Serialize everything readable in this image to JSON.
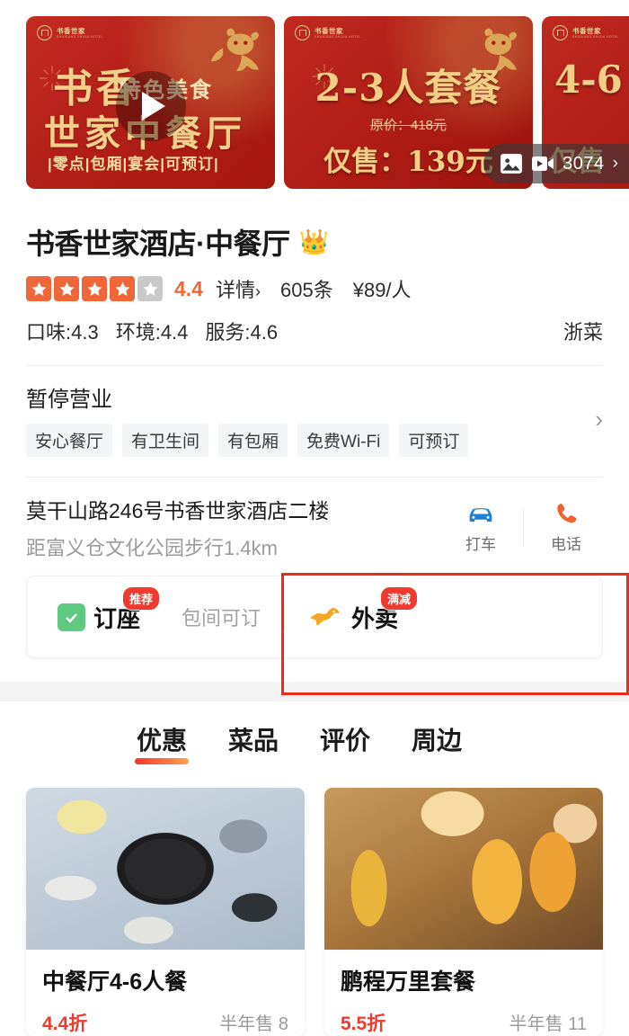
{
  "carousel": {
    "slides": [
      {
        "brand_name": "书香世家",
        "brand_sub": "SHUXIANG SHIJIA HOTEL",
        "line1": "书香",
        "subtitle": "特色美食",
        "line2": "世家中餐厅",
        "footer": "|零点|包厢|宴会|可预订|",
        "has_play": true
      },
      {
        "brand_name": "书香世家",
        "brand_sub": "SHUXIANG SHIJIA HOTEL",
        "headline": "2-3人套餐",
        "original_price": "原价：418元",
        "sale_price": "仅售：139元"
      },
      {
        "brand_name": "书香世家",
        "brand_sub": "SHUXIANG SHIJIA HOTEL",
        "headline": "4-6",
        "sale_price": "仅售"
      }
    ],
    "media_badge": {
      "photo_icon": "image-icon",
      "video_icon": "video-icon",
      "count": "3074",
      "chevron": "›"
    }
  },
  "shop": {
    "title": "书香世家酒店·中餐厅",
    "crown": "👑",
    "rating": {
      "filled_stars": 4,
      "total_stars": 5,
      "score": "4.4",
      "detail_label": "详情",
      "detail_chevron": "›",
      "review_count": "605条",
      "avg_price": "¥89/人"
    },
    "sub_scores": [
      "口味:4.3",
      "环境:4.4",
      "服务:4.6"
    ],
    "cuisine": "浙菜",
    "status": "暂停营业",
    "tags": [
      "安心餐厅",
      "有卫生间",
      "有包厢",
      "免费Wi-Fi",
      "可预订"
    ],
    "status_chevron": "›",
    "address": "莫干山路246号书香世家酒店二楼",
    "distance": "距富义仓文化公园步行1.4km",
    "actions": [
      {
        "icon": "taxi-icon",
        "label": "打车",
        "color": "#1d7fd6"
      },
      {
        "icon": "phone-icon",
        "label": "电话",
        "color": "#f4622a"
      }
    ]
  },
  "booking": {
    "reserve": {
      "label": "订座",
      "badge": "推荐",
      "icon": "check-icon"
    },
    "room_hint": "包间可订",
    "takeout": {
      "label": "外卖",
      "badge": "满减",
      "icon": "kangaroo-icon"
    }
  },
  "tabs": [
    {
      "label": "优惠",
      "active": true
    },
    {
      "label": "菜品",
      "active": false
    },
    {
      "label": "评价",
      "active": false
    },
    {
      "label": "周边",
      "active": false
    }
  ],
  "deals": [
    {
      "title": "中餐厅4-6人餐",
      "discount": "4.4折",
      "sold": "半年售 8"
    },
    {
      "title": "鹏程万里套餐",
      "discount": "5.5折",
      "sold": "半年售 11"
    }
  ],
  "annotation": {
    "color": "#e82c1e"
  }
}
